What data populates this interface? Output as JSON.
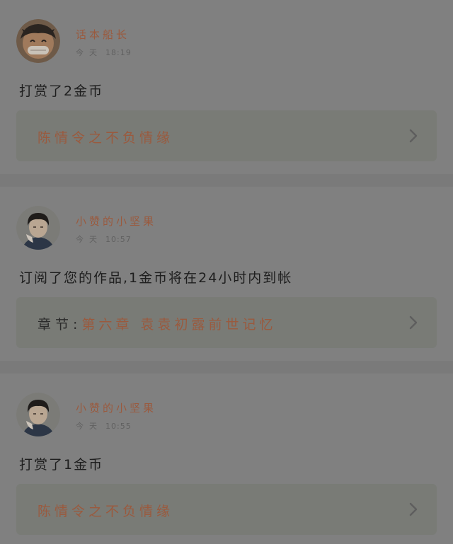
{
  "feed": [
    {
      "user": "话本船长",
      "day": "今天",
      "time": "18:19",
      "message": "打赏了2金币",
      "link_prefix": "",
      "link_title": "陈情令之不负情缘",
      "avatar_icon": "cartoon-pirate-avatar",
      "link_icon": "chevron-right-icon"
    },
    {
      "user": "小赞的小坚果",
      "day": "今天",
      "time": "10:57",
      "message": "订阅了您的作品,1金币将在24小时内到帐",
      "link_prefix": "章节:",
      "link_title": "第六章 袁袁初露前世记忆",
      "avatar_icon": "person-photo-avatar",
      "link_icon": "chevron-right-icon"
    },
    {
      "user": "小赞的小坚果",
      "day": "今天",
      "time": "10:55",
      "message": "打赏了1金币",
      "link_prefix": "",
      "link_title": "陈情令之不负情缘",
      "avatar_icon": "person-photo-avatar",
      "link_icon": "chevron-right-icon"
    }
  ],
  "colors": {
    "accent": "#9a5a3e",
    "text": "#1e1e1e",
    "background": "#808080",
    "link_box": "#797b76"
  }
}
